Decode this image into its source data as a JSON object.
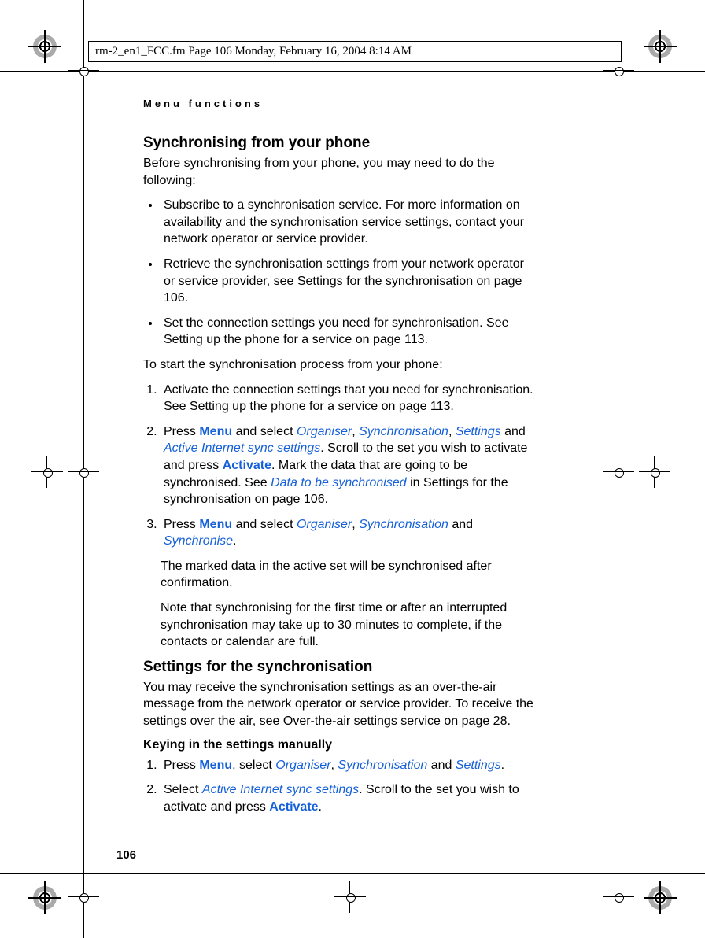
{
  "header_stamp": "rm-2_en1_FCC.fm  Page 106  Monday, February 16, 2004  8:14 AM",
  "running_head": "Menu functions",
  "page_number": "106",
  "s1": {
    "title": "Synchronising from your phone",
    "intro": "Before synchronising from your phone, you may need to do the following:",
    "b1": "Subscribe to a synchronisation service. For more information on availability and the synchronisation service settings, contact your network operator or service provider.",
    "b2": "Retrieve the synchronisation settings from your network operator or service provider, see Settings for the synchronisation on page 106.",
    "b3": "Set the connection settings you need for synchronisation. See Setting up the phone for a service on page 113.",
    "lead": "To start the synchronisation process from your phone:",
    "n1": "Activate the connection settings that you need for synchronisation. See Setting up the phone for a service on page 113.",
    "n2_a": "Press ",
    "n2_menu": "Menu",
    "n2_b": " and select ",
    "n2_organiser": "Organiser",
    "n2_c": ", ",
    "n2_sync": "Synchronisation",
    "n2_d": ", ",
    "n2_settings": "Settings",
    "n2_e": " and ",
    "n2_active": "Active Internet sync settings",
    "n2_f": ". Scroll to the set you wish to activate and press ",
    "n2_activate": "Activate",
    "n2_g": ". Mark the data that are going to be synchronised. See ",
    "n2_data": "Data to be synchronised",
    "n2_h": " in Settings for the synchronisation on page 106.",
    "n3_a": "Press ",
    "n3_menu": "Menu",
    "n3_b": " and select ",
    "n3_organiser": "Organiser",
    "n3_c": ", ",
    "n3_sync": "Synchronisation",
    "n3_d": " and ",
    "n3_synchronise": "Synchronise",
    "n3_e": ".",
    "n3_p1": "The marked data in the active set will be synchronised after confirmation.",
    "n3_p2": "Note that synchronising for the first time or after an interrupted synchronisation may take up to 30 minutes to complete, if the contacts or calendar are full."
  },
  "s2": {
    "title": "Settings for the synchronisation",
    "intro": "You may receive the synchronisation settings as an over-the-air message from the network operator or service provider. To receive the settings over the air, see Over-the-air settings service on page 28.",
    "sub": "Keying in the settings manually",
    "n1_a": "Press ",
    "n1_menu": "Menu",
    "n1_b": ", select ",
    "n1_organiser": "Organiser",
    "n1_c": ", ",
    "n1_sync": "Synchronisation",
    "n1_d": " and ",
    "n1_settings": "Settings",
    "n1_e": ".",
    "n2_a": "Select ",
    "n2_active": "Active Internet sync settings",
    "n2_b": ". Scroll to the set you wish to activate and press ",
    "n2_activate": "Activate",
    "n2_c": "."
  }
}
